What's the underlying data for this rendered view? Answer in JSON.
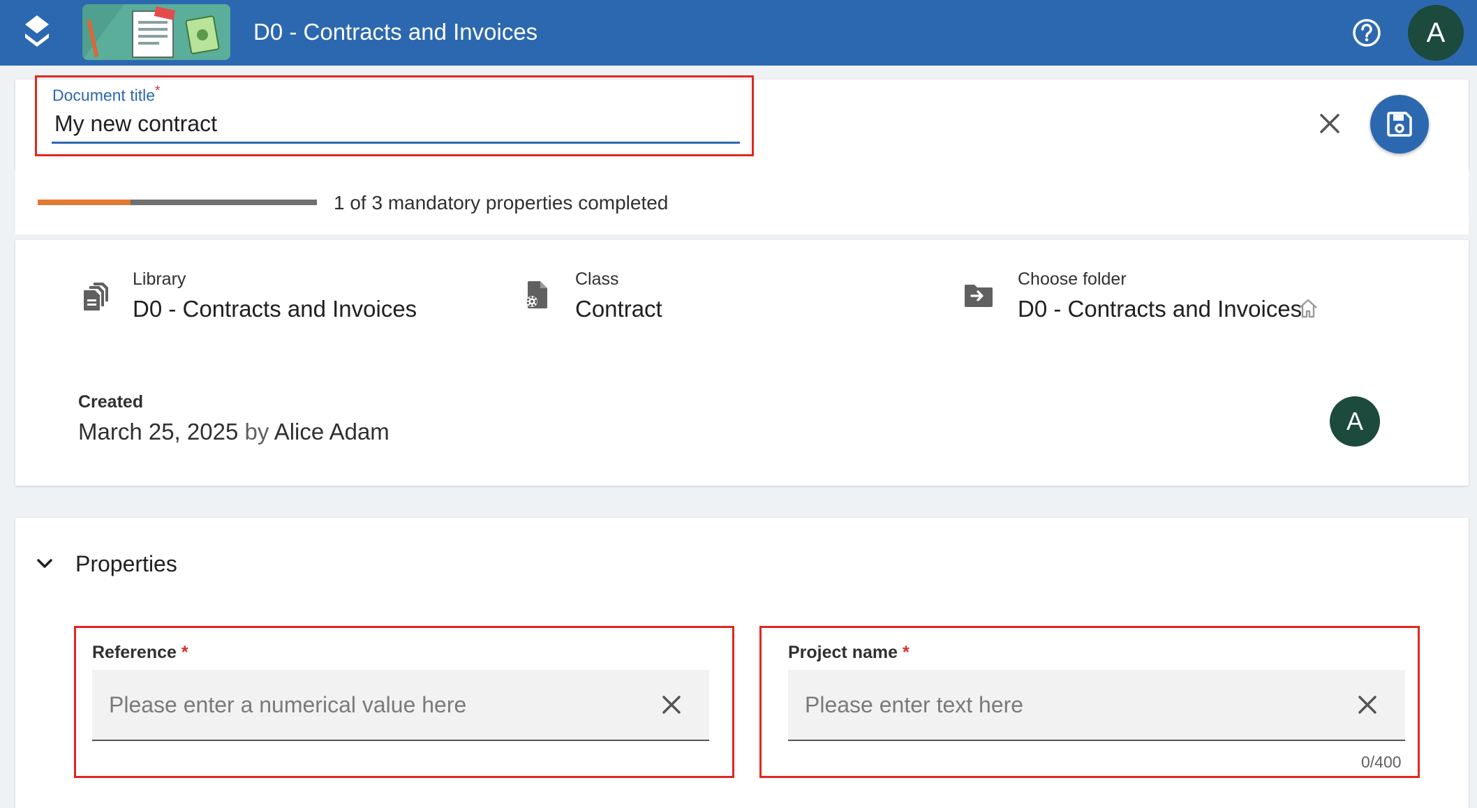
{
  "header": {
    "app_title": "D0 - Contracts and Invoices",
    "logo_icon": "stacked-layers-icon",
    "help_icon": "help-circle-icon",
    "user_initial": "A",
    "bar_color": "#2c68b0"
  },
  "title_field": {
    "label": "Document title",
    "required_mark": "*",
    "value": "My new contract",
    "clear_icon": "close-icon",
    "save_icon": "save-icon"
  },
  "progress": {
    "completed": 1,
    "total": 3,
    "text": "1 of 3 mandatory properties completed",
    "fill_color": "#e07a33"
  },
  "info": {
    "library": {
      "label": "Library",
      "value": "D0 - Contracts and Invoices",
      "icon": "library-documents-icon"
    },
    "class": {
      "label": "Class",
      "value": "Contract",
      "icon": "document-gear-icon"
    },
    "folder": {
      "label": "Choose folder",
      "value": "D0 - Contracts and Invoices",
      "icon": "folder-move-icon",
      "home_icon": "home-icon"
    },
    "created": {
      "label": "Created",
      "date": "March 25, 2025",
      "by_word": "by",
      "author": "Alice Adam",
      "avatar_initial": "A"
    }
  },
  "properties": {
    "section_title": "Properties",
    "toggle_icon": "chevron-down-icon",
    "fields": [
      {
        "label": "Reference",
        "required_mark": "*",
        "placeholder": "Please enter a numerical value here",
        "value": ""
      },
      {
        "label": "Project name",
        "required_mark": "*",
        "placeholder": "Please enter text here",
        "value": "",
        "counter": "0/400"
      }
    ]
  },
  "accent_colors": {
    "primary": "#2c68b0",
    "highlight": "#e0271f",
    "avatar": "#1c4a3d"
  }
}
